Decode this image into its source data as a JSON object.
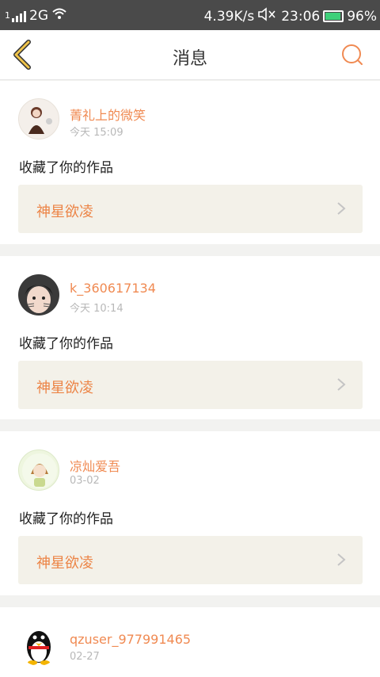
{
  "status_bar": {
    "sim_slot": "1",
    "network": "2G",
    "speed": "4.39K/s",
    "time": "23:06",
    "battery": "96%",
    "icons": [
      "signal-icon",
      "wifi-icon",
      "mute-icon",
      "battery-icon"
    ]
  },
  "header": {
    "back_icon": "chevron-left-icon",
    "title": "消息",
    "search_icon": "search-icon"
  },
  "colors": {
    "accent": "#f08a52",
    "back_arrow": "#f0c44a",
    "card_bg": "#ffffff",
    "page_bg": "#f2f2f0",
    "work_bg": "#f3f1e9"
  },
  "messages": [
    {
      "username": "菁礼上的微笑",
      "time": "今天 15:09",
      "text": "收藏了你的作品",
      "work_title": "神星欲凌",
      "avatar_icon": "avatar-girl-brown-icon"
    },
    {
      "username": "k_360617134",
      "time": "今天 10:14",
      "text": "收藏了你的作品",
      "work_title": "神星欲凌",
      "avatar_icon": "avatar-cat-face-icon"
    },
    {
      "username": "凉灿爱吾",
      "time": "03-02",
      "text": "收藏了你的作品",
      "work_title": "神星欲凌",
      "avatar_icon": "avatar-girl-green-icon"
    },
    {
      "username": "qzuser_977991465",
      "time": "02-27",
      "avatar_icon": "avatar-penguin-icon"
    }
  ]
}
